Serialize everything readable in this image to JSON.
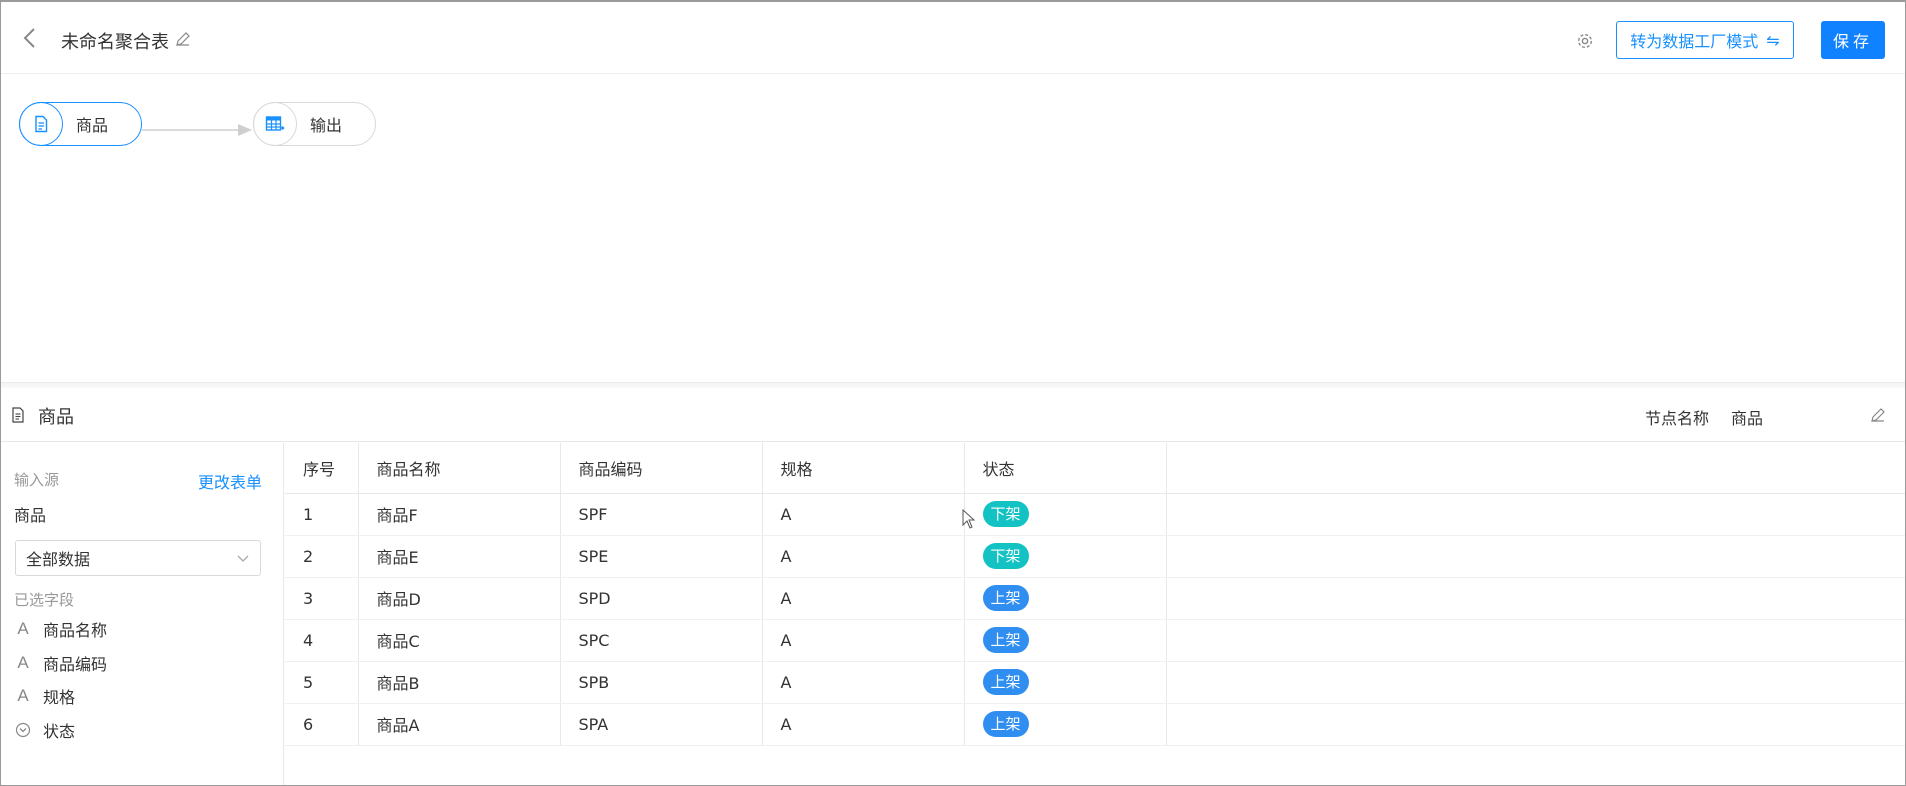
{
  "header": {
    "title": "未命名聚合表",
    "convert_label": "转为数据工厂模式",
    "convert_symbol": "⇋",
    "save_label": "保存"
  },
  "flow": {
    "source_node_label": "商品",
    "output_node_label": "输出"
  },
  "panel": {
    "title": "商品",
    "node_name_label": "节点名称",
    "node_name_value": "商品"
  },
  "side": {
    "input_source_label": "输入源",
    "change_form_label": "更改表单",
    "form_name": "商品",
    "data_scope_value": "全部数据",
    "selected_fields_label": "已选字段",
    "fields": [
      {
        "label": "商品名称",
        "icon": "text-field-icon"
      },
      {
        "label": "商品编码",
        "icon": "text-field-icon"
      },
      {
        "label": "规格",
        "icon": "text-field-icon"
      },
      {
        "label": "状态",
        "icon": "dropdown-field-icon"
      }
    ]
  },
  "table": {
    "columns": [
      "序号",
      "商品名称",
      "商品编码",
      "规格",
      "状态"
    ],
    "rows": [
      {
        "index": "1",
        "name": "商品F",
        "code": "SPF",
        "spec": "A",
        "status": "下架"
      },
      {
        "index": "2",
        "name": "商品E",
        "code": "SPE",
        "spec": "A",
        "status": "下架"
      },
      {
        "index": "3",
        "name": "商品D",
        "code": "SPD",
        "spec": "A",
        "status": "上架"
      },
      {
        "index": "4",
        "name": "商品C",
        "code": "SPC",
        "spec": "A",
        "status": "上架"
      },
      {
        "index": "5",
        "name": "商品B",
        "code": "SPB",
        "spec": "A",
        "status": "上架"
      },
      {
        "index": "6",
        "name": "商品A",
        "code": "SPA",
        "spec": "A",
        "status": "上架"
      }
    ],
    "status_colors": {
      "下架": "#13c2c2",
      "上架": "#2f8ef0"
    }
  },
  "colors": {
    "accent": "#1890ff",
    "save_button": "#1082ff"
  }
}
